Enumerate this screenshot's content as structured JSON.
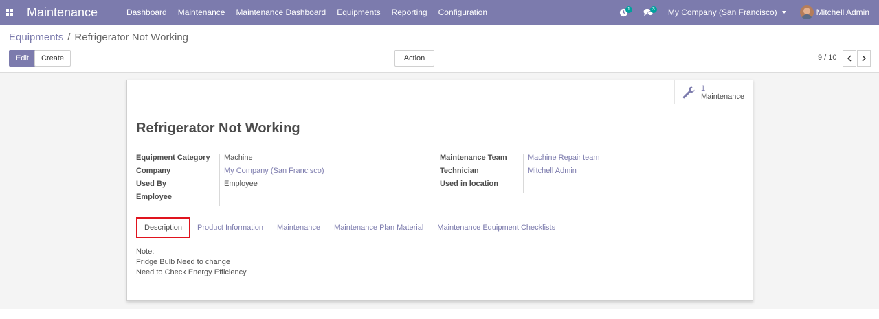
{
  "navbar": {
    "app_title": "Maintenance",
    "menu": [
      "Dashboard",
      "Maintenance",
      "Maintenance Dashboard",
      "Equipments",
      "Reporting",
      "Configuration"
    ],
    "activity_count": "1",
    "messages_count": "3",
    "company": "My Company (San Francisco)",
    "user": "Mitchell Admin",
    "icons": [
      "apps-icon",
      "clock-icon",
      "chat-icon",
      "caret-down-icon",
      "avatar"
    ]
  },
  "breadcrumb": {
    "parent": "Equipments",
    "current": "Refrigerator Not Working"
  },
  "toolbar": {
    "edit_label": "Edit",
    "create_label": "Create",
    "action_label": "Action",
    "pager_value": "9 / 10"
  },
  "stat_button": {
    "count": "1",
    "label": "Maintenance",
    "icon": "wrench-icon"
  },
  "record": {
    "title": "Refrigerator Not Working",
    "left_fields": [
      {
        "label": "Equipment Category",
        "value": "Machine",
        "link": false
      },
      {
        "label": "Company",
        "value": "My Company (San Francisco)",
        "link": true
      },
      {
        "label": "Used By",
        "value": "Employee",
        "link": false
      },
      {
        "label": "Employee",
        "value": "",
        "link": false
      }
    ],
    "right_fields": [
      {
        "label": "Maintenance Team",
        "value": "Machine Repair team",
        "link": true
      },
      {
        "label": "Technician",
        "value": "Mitchell Admin",
        "link": true
      },
      {
        "label": "Used in location",
        "value": "",
        "link": false
      }
    ]
  },
  "tabs": [
    "Description",
    "Product Information",
    "Maintenance",
    "Maintenance Plan Material",
    "Maintenance Equipment Checklists"
  ],
  "active_tab": "Description",
  "description_lines": [
    "Note:",
    "Fridge Bulb Need to change",
    "Need to Check Energy Efficiency"
  ],
  "colors": {
    "brand": "#7c7bad",
    "badge": "#00a09d",
    "highlight": "#e0141e"
  }
}
